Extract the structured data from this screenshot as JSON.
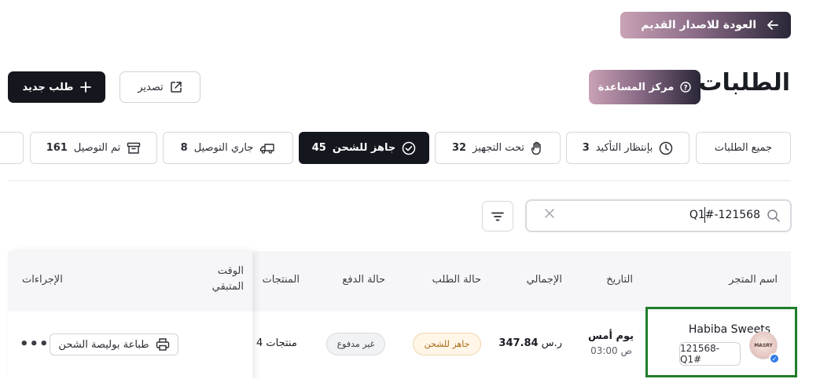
{
  "header": {
    "back_label": "العودة للاصدار القديم",
    "title": "الطلبات",
    "help_label": "مركز المساعدة",
    "export_label": "تصدير",
    "new_order_label": "طلب جديد"
  },
  "tabs": [
    {
      "label": "جميع الطلبات",
      "count": "",
      "icon": "none"
    },
    {
      "label": "بإنتظار التأكيد",
      "count": "3",
      "icon": "clock-icon"
    },
    {
      "label": "تحت التجهيز",
      "count": "32",
      "icon": "hand-icon"
    },
    {
      "label": "جاهز للشحن",
      "count": "45",
      "icon": "check-circle-icon",
      "active": true
    },
    {
      "label": "جاري التوصيل",
      "count": "8",
      "icon": "truck-icon"
    },
    {
      "label": "تم التوصيل",
      "count": "161",
      "icon": "box-icon"
    }
  ],
  "search": {
    "value": "Q1#-121568"
  },
  "table": {
    "columns": [
      "اسم المتجر",
      "التاريخ",
      "الإجمالي",
      "حالة الطلب",
      "حالة الدفع",
      "المنتجات",
      "الوقت المتبقي",
      "الإجراءات"
    ],
    "rows": [
      {
        "store_name": "Habiba Sweets",
        "store_id": "121568-Q1#",
        "avatar_text": "MASRY",
        "date_line1": "يوم أمس",
        "date_line2": "03:00 ص",
        "total_value": "347.84",
        "total_currency": "ر.س",
        "order_status": "جاهز للشحن",
        "payment_status": "غير مدفوع",
        "products": "4 منتجات",
        "action_label": "طباعة بوليصة الشحن"
      }
    ]
  },
  "colors": {
    "accent_dark": "#15171e",
    "gradient_start": "#c9a2b5",
    "gradient_end": "#2a2638",
    "status_orange": "#a86a12",
    "highlight_green": "#1f7d2a"
  }
}
